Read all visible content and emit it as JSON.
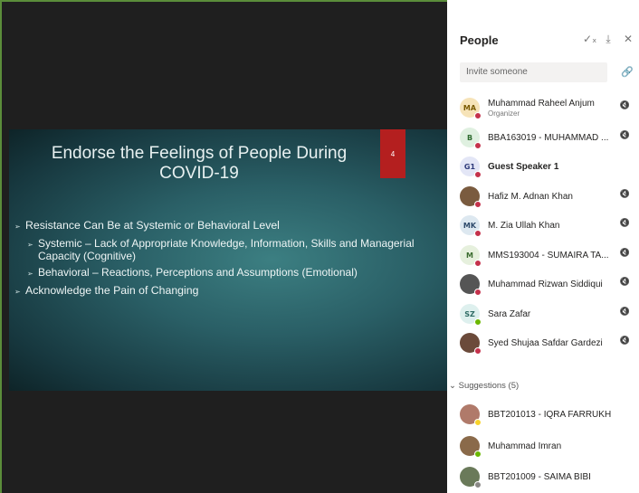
{
  "slide": {
    "title": "Endorse the Feelings of People During COVID-19",
    "number": "4",
    "bullets": [
      {
        "text": "Resistance Can Be at Systemic or Behavioral Level",
        "level": 0
      },
      {
        "text": "Systemic – Lack of Appropriate Knowledge, Information, Skills and Managerial Capacity (Cognitive)",
        "level": 1
      },
      {
        "text": "Behavioral – Reactions, Perceptions and Assumptions (Emotional)",
        "level": 1
      },
      {
        "text": "Acknowledge the Pain of Changing",
        "level": 0
      }
    ]
  },
  "panel": {
    "title": "People",
    "icons": [
      "mute-all-icon",
      "download-icon",
      "close-icon"
    ],
    "invite_placeholder": "Invite someone",
    "suggestions_label": "Suggestions (5)",
    "participants": [
      {
        "initials": "MA",
        "name": "Muhammad Raheel Anjum",
        "role": "Organizer",
        "avatar_bg": "#f6e3b8",
        "avatar_fg": "#7a5a00",
        "status": "#c4314b",
        "muted": true,
        "bold": false
      },
      {
        "initials": "B",
        "name": "BBA163019 - MUHAMMAD ...",
        "role": "",
        "avatar_bg": "#dff0e0",
        "avatar_fg": "#2e6b2f",
        "status": "#c4314b",
        "muted": true,
        "bold": false
      },
      {
        "initials": "G1",
        "name": "Guest Speaker 1",
        "role": "",
        "avatar_bg": "#e3e6f6",
        "avatar_fg": "#2e3a7a",
        "status": "#c4314b",
        "muted": false,
        "bold": true
      },
      {
        "initials": "",
        "name": "Hafiz M. Adnan Khan",
        "role": "",
        "avatar_bg": "#7a5b3f",
        "avatar_fg": "#fff",
        "status": "#c4314b",
        "muted": true,
        "bold": false
      },
      {
        "initials": "MK",
        "name": "M. Zia Ullah Khan",
        "role": "",
        "avatar_bg": "#dde8f0",
        "avatar_fg": "#2e4a6b",
        "status": "#c4314b",
        "muted": true,
        "bold": false
      },
      {
        "initials": "M",
        "name": "MMS193004 - SUMAIRA TA...",
        "role": "",
        "avatar_bg": "#e6f0dd",
        "avatar_fg": "#3a6b2e",
        "status": "#c4314b",
        "muted": true,
        "bold": false
      },
      {
        "initials": "",
        "name": "Muhammad Rizwan Siddiqui",
        "role": "",
        "avatar_bg": "#555",
        "avatar_fg": "#fff",
        "status": "#c4314b",
        "muted": true,
        "bold": false
      },
      {
        "initials": "SZ",
        "name": "Sara Zafar",
        "role": "",
        "avatar_bg": "#def0ee",
        "avatar_fg": "#2e6b64",
        "status": "#6bb700",
        "muted": true,
        "bold": false
      },
      {
        "initials": "",
        "name": "Syed Shujaa Safdar Gardezi",
        "role": "",
        "avatar_bg": "#6b4a3a",
        "avatar_fg": "#fff",
        "status": "#c4314b",
        "muted": true,
        "bold": false
      }
    ],
    "suggestions": [
      {
        "initials": "",
        "name": "BBT201013 - IQRA FARRUKH",
        "avatar_bg": "#b07a6a",
        "status": "#f8d22a"
      },
      {
        "initials": "",
        "name": "Muhammad Imran",
        "avatar_bg": "#8a6a4a",
        "status": "#6bb700"
      },
      {
        "initials": "",
        "name": "BBT201009 - SAIMA BIBI",
        "avatar_bg": "#6a7a5a",
        "status": "#8a8886"
      }
    ]
  }
}
